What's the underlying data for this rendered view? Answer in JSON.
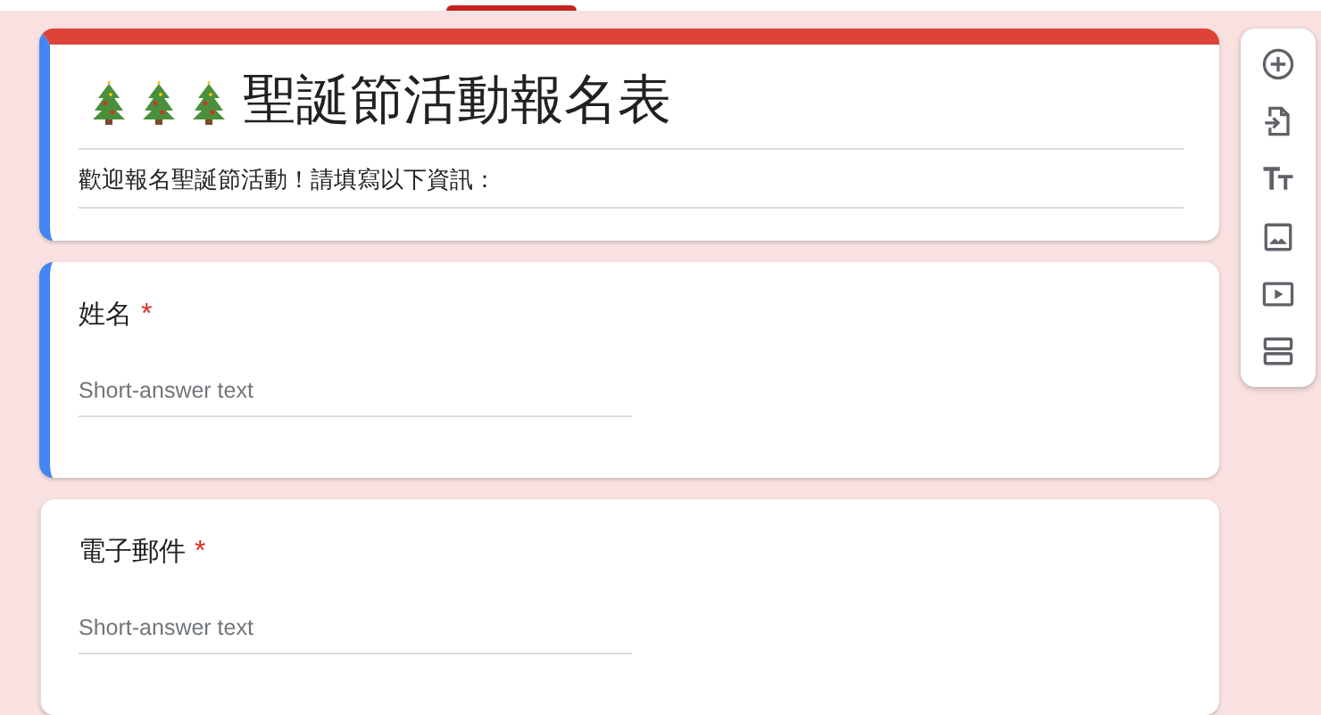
{
  "header": {
    "title": "聖誕節活動報名表",
    "title_icons": [
      {
        "kind": "tree"
      },
      {
        "kind": "tree"
      },
      {
        "kind": "tree"
      }
    ],
    "description": "歡迎報名聖誕節活動！請填寫以下資訊：",
    "selected": true
  },
  "questions": [
    {
      "label": "姓名",
      "required": true,
      "required_mark": "*",
      "placeholder": "Short-answer text",
      "selected": true
    },
    {
      "label": "電子郵件",
      "required": true,
      "required_mark": "*",
      "placeholder": "Short-answer text",
      "selected": false
    }
  ],
  "toolbar": [
    {
      "kind": "add"
    },
    {
      "kind": "import"
    },
    {
      "kind": "text"
    },
    {
      "kind": "image"
    },
    {
      "kind": "video"
    },
    {
      "kind": "section"
    }
  ]
}
